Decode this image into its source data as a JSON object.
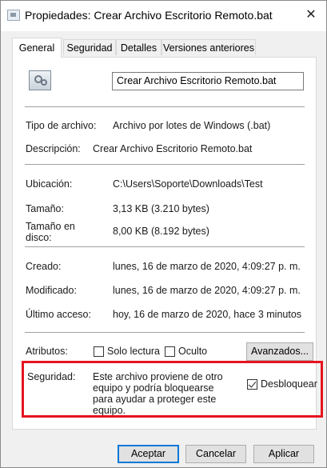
{
  "window": {
    "title": "Propiedades: Crear Archivo Escritorio Remoto.bat",
    "close_label": "✕"
  },
  "tabs": [
    {
      "label": "General"
    },
    {
      "label": "Seguridad"
    },
    {
      "label": "Detalles"
    },
    {
      "label": "Versiones anteriores"
    }
  ],
  "general": {
    "file_name": "Crear Archivo Escritorio Remoto.bat",
    "file_type_label": "Tipo de archivo:",
    "file_type_value": "Archivo por lotes de Windows (.bat)",
    "description_label": "Descripción:",
    "description_value": "Crear Archivo Escritorio Remoto.bat",
    "location_label": "Ubicación:",
    "location_value": "C:\\Users\\Soporte\\Downloads\\Test",
    "size_label": "Tamaño:",
    "size_value": "3,13 KB (3.210 bytes)",
    "size_on_disk_label": "Tamaño en disco:",
    "size_on_disk_value": "8,00 KB (8.192 bytes)",
    "created_label": "Creado:",
    "created_value": "lunes, 16 de marzo de 2020, 4:09:27 p. m.",
    "modified_label": "Modificado:",
    "modified_value": "lunes, 16 de marzo de 2020, 4:09:27 p. m.",
    "accessed_label": "Último acceso:",
    "accessed_value": "hoy, 16 de marzo de 2020, hace 3 minutos",
    "attributes_label": "Atributos:",
    "readonly_label": "Solo lectura",
    "readonly_checked": false,
    "hidden_label": "Oculto",
    "hidden_checked": false,
    "advanced_button": "Avanzados...",
    "security_label": "Seguridad:",
    "security_text": "Este archivo proviene de otro equipo y podría bloquearse para ayudar a proteger este equipo.",
    "unblock_label": "Desbloquear",
    "unblock_checked": true
  },
  "footer": {
    "ok_label": "Aceptar",
    "cancel_label": "Cancelar",
    "apply_label": "Aplicar"
  },
  "colors": {
    "highlight_border": "#e6141f",
    "focus_border": "#0078d7"
  }
}
